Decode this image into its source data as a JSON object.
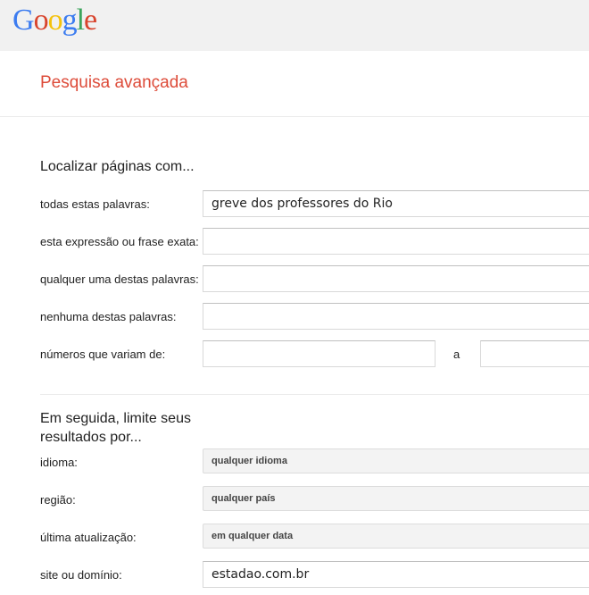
{
  "logo": "Google",
  "title": "Pesquisa avançada",
  "section1": {
    "heading": "Localizar páginas com...",
    "rows": [
      {
        "label": "todas estas palavras:",
        "value": "greve dos professores do Rio"
      },
      {
        "label": "esta expressão ou frase exata:",
        "value": ""
      },
      {
        "label": "qualquer uma destas palavras:",
        "value": ""
      },
      {
        "label": "nenhuma destas palavras:",
        "value": ""
      }
    ],
    "range": {
      "label": "números que variam de:",
      "from": "",
      "separator": "a",
      "to": ""
    }
  },
  "section2": {
    "heading": "Em seguida, limite seus resultados por...",
    "language": {
      "label": "idioma:",
      "value": "qualquer idioma"
    },
    "region": {
      "label": "região:",
      "value": "qualquer país"
    },
    "updated": {
      "label": "última atualização:",
      "value": "em qualquer data"
    },
    "site": {
      "label": "site ou domínio:",
      "value": "estadao.com.br"
    }
  },
  "colors": {
    "title": "#dd4b39",
    "header": "#f1f1f1"
  }
}
